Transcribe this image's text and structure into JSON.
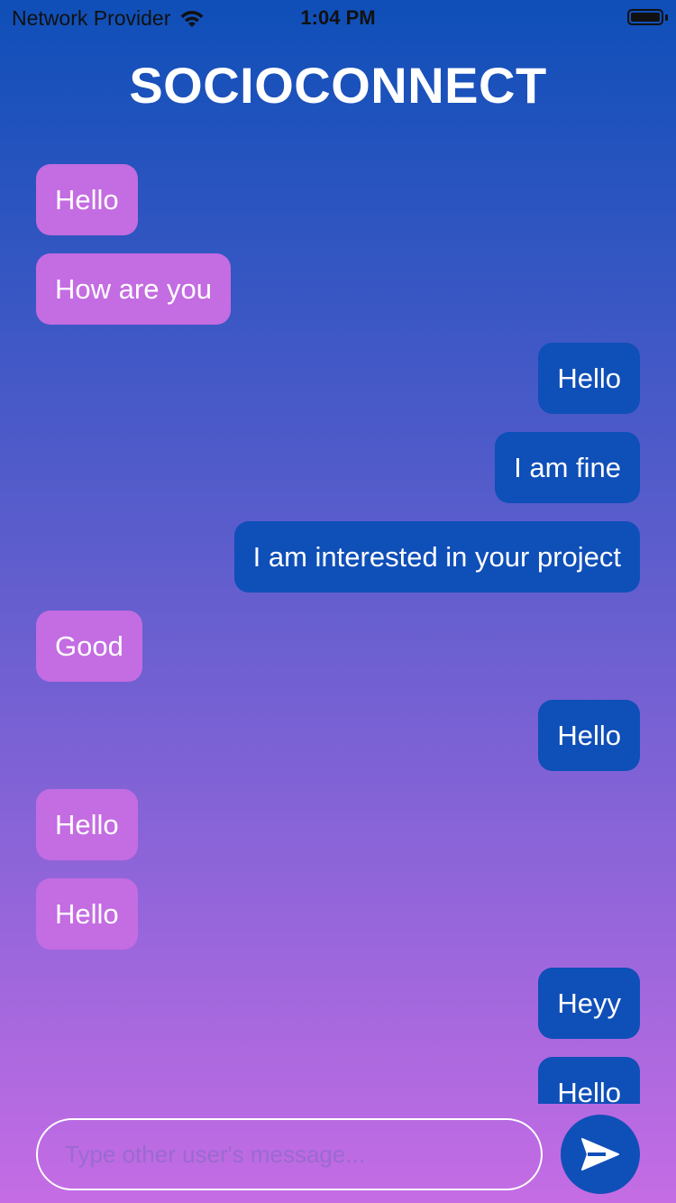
{
  "status_bar": {
    "carrier": "Network Provider",
    "time": "1:04 PM"
  },
  "header": {
    "title": "SOCIOCONNECT"
  },
  "messages": [
    {
      "text": "Hello",
      "direction": "incoming"
    },
    {
      "text": "How are you",
      "direction": "incoming"
    },
    {
      "text": "Hello",
      "direction": "outgoing"
    },
    {
      "text": "I am fine",
      "direction": "outgoing"
    },
    {
      "text": "I am interested in your project",
      "direction": "outgoing"
    },
    {
      "text": "Good",
      "direction": "incoming"
    },
    {
      "text": "Hello",
      "direction": "outgoing"
    },
    {
      "text": "Hello",
      "direction": "incoming"
    },
    {
      "text": "Hello",
      "direction": "incoming"
    },
    {
      "text": "Heyy",
      "direction": "outgoing"
    },
    {
      "text": "Hello",
      "direction": "outgoing"
    }
  ],
  "composer": {
    "placeholder": "Type other user's message...",
    "value": "",
    "send_icon": "send-icon"
  },
  "colors": {
    "incoming_bubble": "#c46ce2",
    "outgoing_bubble": "#0f4fb8",
    "send_button": "#0f4fb8"
  }
}
